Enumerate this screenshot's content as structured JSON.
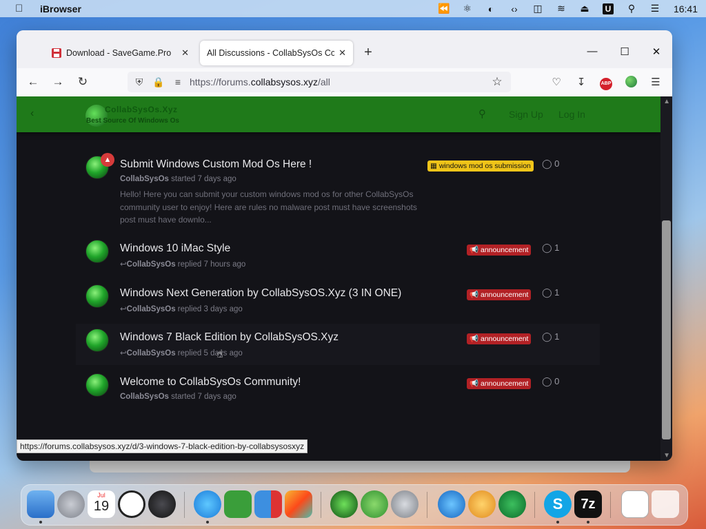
{
  "menubar": {
    "app_name": "iBrowser",
    "clock": "16:41",
    "u_label": "U"
  },
  "browser": {
    "tabs": [
      {
        "title": "Download - SaveGame.Pro",
        "favicon": "save-icon"
      },
      {
        "title": "All Discussions - CollabSysOs Comm",
        "favicon": "none"
      }
    ],
    "url_host": "https://forums.",
    "url_domain": "collabsysos.xyz",
    "url_path": "/all",
    "abp_label": "ABP",
    "status_url": "https://forums.collabsysos.xyz/d/3-windows-7-black-edition-by-collabsysosxyz"
  },
  "site": {
    "logo_title": "CollabSysOs.Xyz",
    "logo_subtitle": "Best Source Of Windows Os",
    "signup": "Sign Up",
    "login": "Log In"
  },
  "discussions": [
    {
      "title": "Submit Windows Custom Mod Os Here !",
      "author": "CollabSysOs",
      "action": "started 7 days ago",
      "excerpt": "Hello! Here you can submit your custom windows mod os for other CollabSysOs community user to enjoy! Here are rules no malware post must have screenshots post must have downlo...",
      "tag": "windows mod os submission",
      "count": "0",
      "pinned": true
    },
    {
      "title": "Windows 10 iMac Style",
      "author": "CollabSysOs",
      "action": "replied 7 hours ago",
      "tag": "announcement",
      "count": "1"
    },
    {
      "title": "Windows Next Generation by CollabSysOS.Xyz (3 IN ONE)",
      "author": "CollabSysOs",
      "action": "replied 3 days ago",
      "tag": "announcement",
      "count": "1"
    },
    {
      "title": "Windows 7 Black Edition by CollabSysOS.Xyz",
      "author": "CollabSysOs",
      "action": "replied 5 days ago",
      "tag": "announcement",
      "count": "1"
    },
    {
      "title": "Welcome to CollabSysOs Community!",
      "author": "CollabSysOs",
      "action": "started 7 days ago",
      "tag": "announcement",
      "count": "0"
    }
  ],
  "dock": {
    "calendar_month": "Jul",
    "calendar_day": "19",
    "skype_label": "S",
    "zip_label": "7z"
  },
  "colors": {
    "header_green": "#1f7a1a",
    "announcement_red": "#b22125",
    "mod_tag_yellow": "#f0c419",
    "page_bg": "#131318"
  }
}
